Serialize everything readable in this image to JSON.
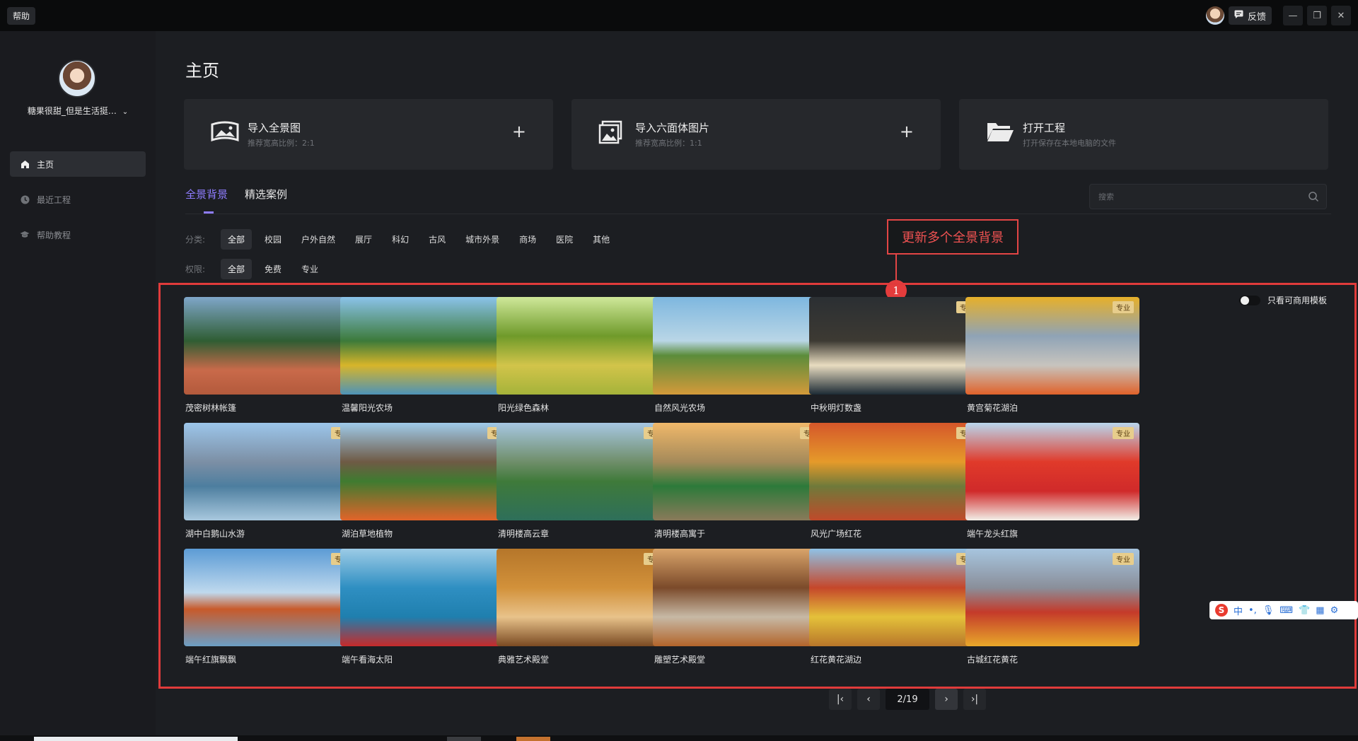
{
  "titlebar": {
    "help": "帮助",
    "feedback": "反馈"
  },
  "sidebar": {
    "username": "糖果很甜_但是生活挺…",
    "items": [
      {
        "label": "主页",
        "icon": "home-icon"
      },
      {
        "label": "最近工程",
        "icon": "clock-icon"
      },
      {
        "label": "帮助教程",
        "icon": "graduation-cap-icon"
      }
    ]
  },
  "main": {
    "title": "主页",
    "cards": [
      {
        "title": "导入全景图",
        "sub": "推荐宽高比例：2:1",
        "icon": "panorama-image-icon"
      },
      {
        "title": "导入六面体图片",
        "sub": "推荐宽高比例：1:1",
        "icon": "image-icon"
      },
      {
        "title": "打开工程",
        "sub": "打开保存在本地电脑的文件",
        "icon": "folder-open-icon"
      }
    ],
    "tabs": [
      "全景背景",
      "精选案例"
    ],
    "search_placeholder": "搜索",
    "annotation": {
      "text": "更新多个全景背景",
      "number": "1"
    },
    "filters": {
      "category_label": "分类:",
      "categories": [
        "全部",
        "校园",
        "户外自然",
        "展厅",
        "科幻",
        "古风",
        "城市外景",
        "商场",
        "医院",
        "其他"
      ],
      "permission_label": "权限:",
      "permissions": [
        "全部",
        "免费",
        "专业"
      ]
    },
    "toggle_label": "只看可商用模板",
    "pro_badge": "专业",
    "thumbnails": [
      {
        "label": "茂密树林帐篷",
        "pro": false
      },
      {
        "label": "温馨阳光农场",
        "pro": false
      },
      {
        "label": "阳光绿色森林",
        "pro": false
      },
      {
        "label": "自然风光农场",
        "pro": false
      },
      {
        "label": "中秋明灯数盏",
        "pro": true
      },
      {
        "label": "黄宫菊花湖泊",
        "pro": true
      },
      {
        "label": "湖中白鹅山水游",
        "pro": true
      },
      {
        "label": "湖泊草地植物",
        "pro": true
      },
      {
        "label": "清明楼高云章",
        "pro": true
      },
      {
        "label": "清明楼高寓于",
        "pro": true
      },
      {
        "label": "风光广场红花",
        "pro": true
      },
      {
        "label": "端午龙头红旗",
        "pro": true
      },
      {
        "label": "端午红旗飘飘",
        "pro": true
      },
      {
        "label": "端午看海太阳",
        "pro": false
      },
      {
        "label": "典雅艺术殿堂",
        "pro": true
      },
      {
        "label": "雕塑艺术殿堂",
        "pro": false
      },
      {
        "label": "红花黄花湖边",
        "pro": true
      },
      {
        "label": "古城红花黄花",
        "pro": true
      }
    ],
    "pager": {
      "current": "2/19"
    }
  },
  "ime": {
    "logo": "S",
    "mode": "中"
  }
}
